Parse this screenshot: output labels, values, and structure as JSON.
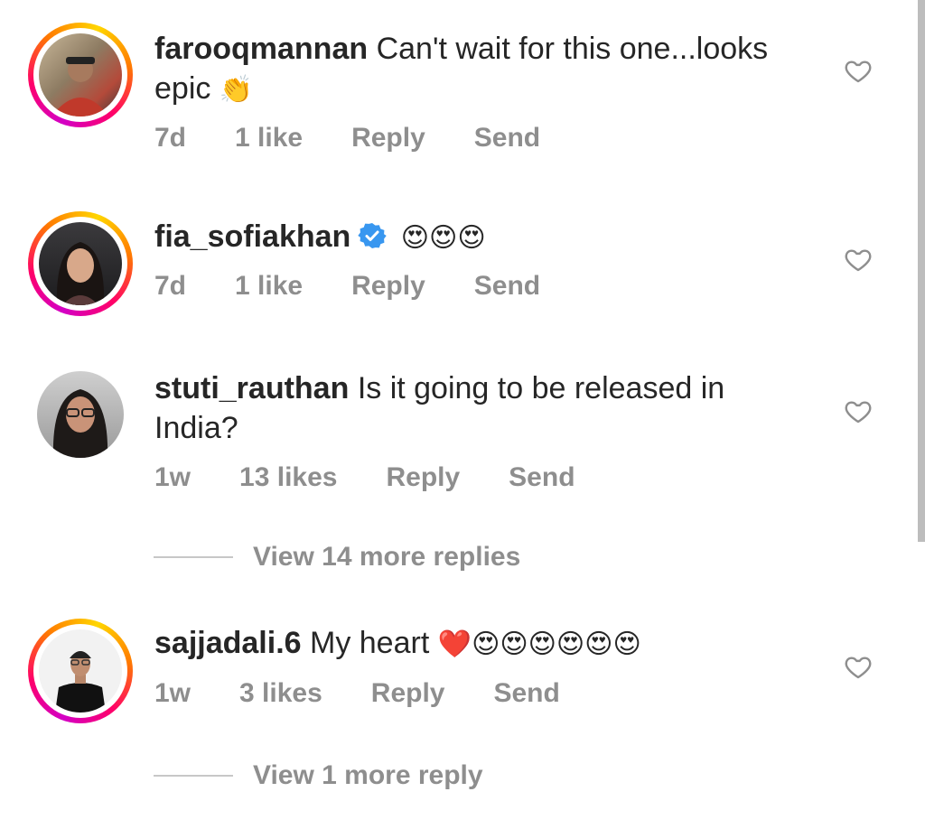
{
  "comments": [
    {
      "username": "farooqmannan",
      "text_line1": "Can't wait for this one...looks",
      "text_line2": "epic",
      "emoji": "👏",
      "time": "7d",
      "likes": "1 like",
      "reply": "Reply",
      "send": "Send"
    },
    {
      "username": "fia_sofiakhan",
      "emoji": "😍😍😍",
      "time": "7d",
      "likes": "1 like",
      "reply": "Reply",
      "send": "Send"
    },
    {
      "username": "stuti_rauthan",
      "text_line1": "Is it going to be released in",
      "text_line2": "India?",
      "time": "1w",
      "likes": "13 likes",
      "reply": "Reply",
      "send": "Send",
      "view_replies": "View 14 more replies"
    },
    {
      "username": "sajjadali.6",
      "text_line1": "My heart",
      "emoji": "❤️😍😍😍😍😍😍",
      "time": "1w",
      "likes": "3 likes",
      "reply": "Reply",
      "send": "Send",
      "view_replies": "View 1 more reply"
    }
  ],
  "icons": {
    "like": "heart-outline-icon",
    "verified": "verified-badge-icon"
  },
  "colors": {
    "text": "#262626",
    "meta": "#8e8e8e",
    "verified": "#3897f0"
  }
}
